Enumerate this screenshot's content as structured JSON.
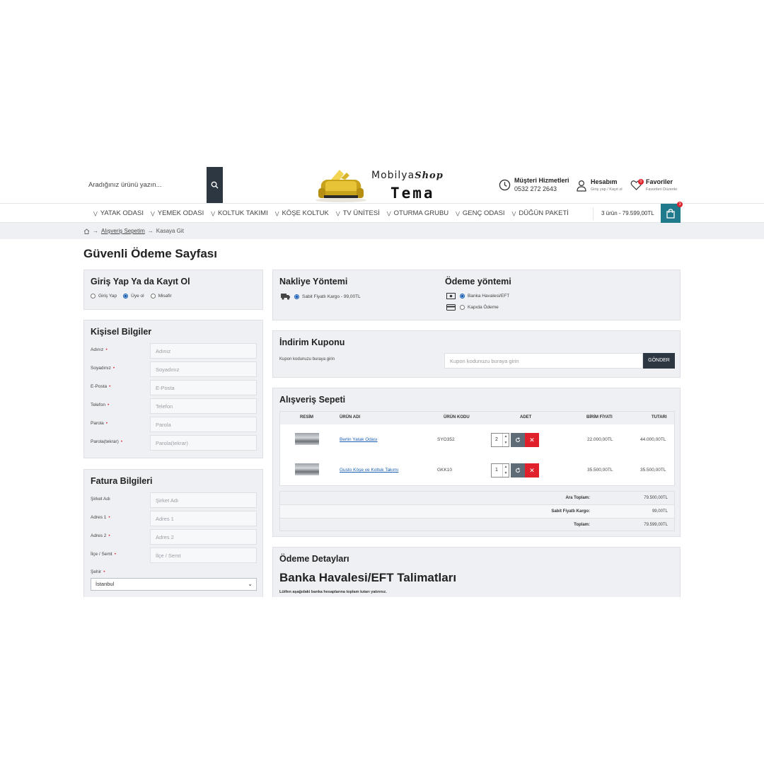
{
  "search": {
    "placeholder": "Aradığınız ürünü yazın..."
  },
  "logo": {
    "line1": "Mobilya",
    "line1_italic": "Shop",
    "line2": "Tema"
  },
  "header": {
    "support": {
      "title": "Müşteri Hizmetleri",
      "phone": "0532 272 2643"
    },
    "account": {
      "title": "Hesabım",
      "sub": "Giriş yap / Kayıt ol"
    },
    "favorites": {
      "title": "Favoriler",
      "sub": "Favorileri Düzenle",
      "count": "0"
    }
  },
  "nav": {
    "items": [
      "YATAK ODASI",
      "YEMEK ODASI",
      "KOLTUK TAKIMI",
      "KÖŞE KOLTUK",
      "TV ÜNİTESİ",
      "OTURMA GRUBU",
      "GENÇ ODASI",
      "DÜĞÜN PAKETİ"
    ],
    "cart_summary": "3 ürün - 79.599,00TL",
    "cart_count": "3"
  },
  "breadcrumb": {
    "cart": "Alışveriş Sepetim",
    "current": "Kasaya Git"
  },
  "page_title": "Güvenli Ödeme Sayfası",
  "login": {
    "title": "Giriş Yap Ya da Kayıt Ol",
    "options": [
      "Giriş Yap",
      "Üye ol",
      "Misafir"
    ],
    "selected": "Üye ol"
  },
  "personal": {
    "title": "Kişisel Bilgiler",
    "fields": [
      {
        "label": "Adınız",
        "placeholder": "Adınız"
      },
      {
        "label": "Soyadınız",
        "placeholder": "Soyadınız"
      },
      {
        "label": "E-Posta",
        "placeholder": "E-Posta"
      },
      {
        "label": "Telefon",
        "placeholder": "Telefon"
      },
      {
        "label": "Parola",
        "placeholder": "Parola"
      },
      {
        "label": "Parola(tekrar)",
        "placeholder": "Parola(tekrar)"
      }
    ]
  },
  "billing": {
    "title": "Fatura Bilgileri",
    "fields": [
      {
        "label": "Şirket Adı",
        "placeholder": "Şirket Adı",
        "required": false
      },
      {
        "label": "Adres 1",
        "placeholder": "Adres 1",
        "required": true
      },
      {
        "label": "Adres 2",
        "placeholder": "Adres 2",
        "required": true
      },
      {
        "label": "İlçe / Semt",
        "placeholder": "İlçe / Semt",
        "required": true
      }
    ],
    "city_label": "Şehir",
    "city_value": "İstanbul"
  },
  "shipping": {
    "title": "Nakliye Yöntemi",
    "option": "Sabit Fiyatlı Kargo - 99,00TL"
  },
  "payment": {
    "title": "Ödeme yöntemi",
    "options": [
      "Banka Havalesi/EFT",
      "Kapıda Ödeme"
    ],
    "selected": "Banka Havalesi/EFT"
  },
  "coupon": {
    "title": "İndirim Kuponu",
    "label": "Kupon kodunuzu buraya girin",
    "placeholder": "Kupon kodunuzu buraya girin",
    "button": "GÖNDER"
  },
  "cart": {
    "title": "Alışveriş Sepeti",
    "headers": [
      "RESİM",
      "ÜRÜN ADI",
      "ÜRÜN KODU",
      "ADET",
      "BİRİM FİYATI",
      "TUTARI"
    ],
    "rows": [
      {
        "name": "Berlin Yatak Odası",
        "code": "SYO352",
        "qty": "2",
        "unit": "22.000,00TL",
        "total": "44.000,00TL"
      },
      {
        "name": "Gusto Köşe ve Koltuk Takımı",
        "code": "GKK10",
        "qty": "1",
        "unit": "35.500,00TL",
        "total": "35.500,00TL"
      }
    ],
    "totals": [
      {
        "label": "Ara Toplam:",
        "value": "79.500,00TL"
      },
      {
        "label": "Sabit Fiyatlı Kargo:",
        "value": "99,00TL"
      },
      {
        "label": "Toplam:",
        "value": "79.599,00TL"
      }
    ]
  },
  "payment_details": {
    "title": "Ödeme Detayları",
    "heading": "Banka Havalesi/EFT Talimatları",
    "text": "Lütfen aşağıdaki banka hesaplarına toplam tutarı yatırınız."
  },
  "colors": {
    "accent": "#1f7a8c",
    "dark": "#2d3741",
    "danger": "#e0202a",
    "panel": "#eef0f3"
  }
}
